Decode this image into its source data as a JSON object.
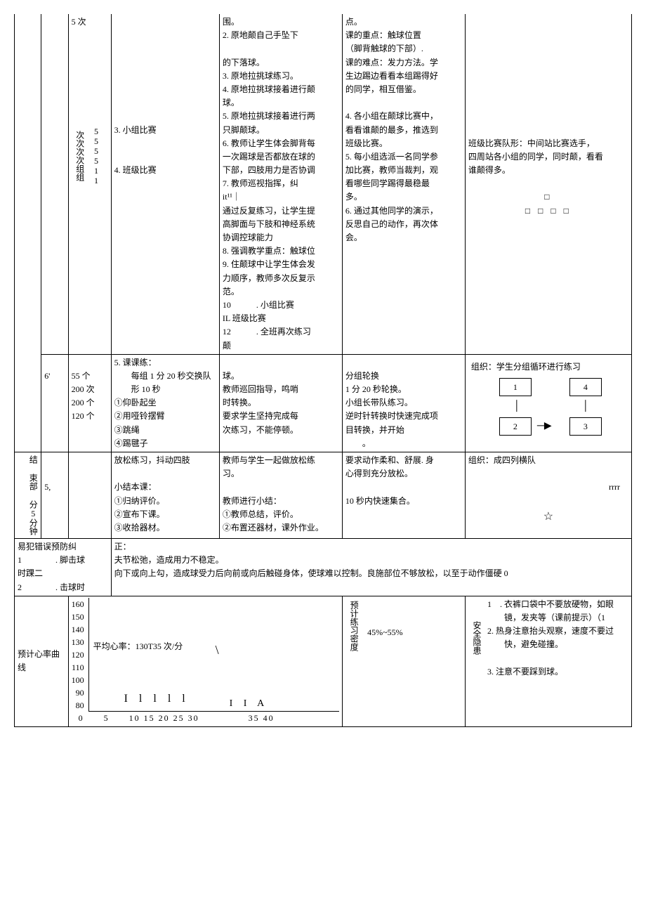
{
  "main": {
    "row1": {
      "reps1": "5 次",
      "reps2_vert": "次次次次组组",
      "reps2_side": "555511",
      "item3": "3. 小组比赛",
      "item4": "4. 班级比赛",
      "mid_a": "围。",
      "mid_b": "2. 原地颠自己手坠下",
      "mid_c": "的下落球。",
      "mid_d": "3. 原地拉挑球练习。",
      "mid_e": "4. 原地拉挑球接着进行颠",
      "mid_f": "球。",
      "mid_g": "5. 原地拉挑球接着进行两",
      "mid_h": "只脚颠球。",
      "mid_i": "6. 教师让学生体会脚背每",
      "mid_j": "一次踢球是否都放在球的",
      "mid_k": "下部，四肢用力是否协调",
      "mid_l": "7. 教师巡视指挥，纠",
      "mid_m": "it¹¹｜",
      "mid_n": "通过反复练习，让学生提",
      "mid_o": "高脚面与下肢和神经系统",
      "mid_p": "协调控球能力",
      "mid_q": "8. 强调教学重点：触球位",
      "mid_r": "9. 住颠球中让学生体会发",
      "mid_s": "力顺序，教师多次反复示",
      "mid_t": "范。",
      "mid_u": "10　　　. 小组比赛",
      "mid_v": "IL 班级比赛",
      "mid_w": "12　　　. 全班再次练习",
      "mid_x": "颠",
      "right_a": "点。",
      "right_b": "课的重点：触球位置",
      "right_c": "（脚背触球的下部）.",
      "right_d": "课的难点：发力方法。学",
      "right_e": "生边踢边看看本组踢得好",
      "right_f": "的同学，相互借鉴。",
      "right_g": "4. 各小组在颠球比赛中，",
      "right_h": "看看谁颠的最多，推选到",
      "right_i": "班级比赛。",
      "right_j": "5. 每小组选派一名同学参",
      "right_k": "加比赛，教师当裁判，观",
      "right_l": "看哪些同学踢得最稳最",
      "right_m": "多。",
      "right_n": "6. 通过其他同学的演示，",
      "right_o": "反思自己的动作，再次体",
      "right_p": "会。",
      "org1_a": "班级比赛队形：中间站比赛选手，",
      "org1_b": "四周站各小组的同学，同时颠，看看",
      "org1_c": "谁颠得多。",
      "sq1": "□",
      "sq2": "□ □ □ □"
    },
    "row2": {
      "time": "6'",
      "reps_a": "55 个",
      "reps_b": "200 次",
      "reps_c": "200 个",
      "reps_d": "120 个",
      "item5_title": "5. 课课练：",
      "item5_sub": "　　每组 1 分 20 秒交换队",
      "item5_sub2": "　　形 10 秒",
      "item5_1": "①仰卧起坐",
      "item5_2": "②用哑铃摆臂",
      "item5_3": "③跳绳",
      "item5_4": "④踢毽子",
      "mid_a": "球。",
      "mid_b": "教师巡回指导，鸣哨",
      "mid_c": "时转换。",
      "mid_d": "要求学生坚持完成每",
      "mid_e": "次练习，不能停顿。",
      "right_a": "分组轮换",
      "right_b": "1 分 20 秒轮换。",
      "right_c": "小组长带队练习。",
      "right_d": "逆时针转换时快速完成项",
      "right_e": "目转换，并开始",
      "right_f": "　　。",
      "org_a": "组织：学生分组循环进行练习",
      "box1": "1",
      "box2": "2",
      "box3": "3",
      "box4": "4",
      "arrow": "▶"
    },
    "end": {
      "label": "结 束部 分5分钟",
      "time": "5,",
      "left_a": "放松练习，抖动四肢",
      "left_b": "小结本课：",
      "left_c": "①归纳评价。",
      "left_d": "②宣布下课。",
      "left_e": "③收拾器材。",
      "mid_a": "教师与学生一起做放松练",
      "mid_b": "习。",
      "mid_c": "教师进行小结：",
      "mid_d": "①教师总结，评价。",
      "mid_e": "②布置还器材，课外作业。",
      "right_a": "要求动作柔和、舒展. 身",
      "right_b": "心得到充分放松。",
      "right_c": "10 秒内快速集合。",
      "org_a": "组织：成四列横队",
      "org_b": "rrrr",
      "org_c": "☆"
    }
  },
  "errors": {
    "title": "易犯错误预防纠",
    "line1": "1　　　　. 脚击球",
    "line2": "时踝二",
    "line3": "2　　　　. 击球时",
    "r1": "正：",
    "r2": "夫节松弛，造成用力不稳定。",
    "r3": "向下或向上勾，造成球受力后向前或向后触碰身体，使球难以控制。良施部位不够放松，以至于动作僵硬 0"
  },
  "bottom": {
    "hr_label": "预计心率曲线",
    "y_vals": [
      "160",
      "150",
      "140",
      "130",
      "120",
      "110",
      "100",
      "90",
      "80"
    ],
    "avg_hr": "平均心率：130T35 次/分",
    "slash": "\\",
    "bars": "I l l l l",
    "iia": "I I A",
    "x_vals": "0　　5　　10 15 20 25 30　　　　　35 40",
    "density_label": "预计练习密度",
    "density_val": "45%~55%",
    "safety_label": "安全隐患",
    "s1": "1　. 衣裤口袋中不要放硬物，如眼",
    "s1b": "　　镜，发夹等（课前提示）（1",
    "s2": "2. 热身注意抬头观察，速度不要过",
    "s2b": "　　快，避免碰撞。",
    "s3": "3. 注意不要踩到球。"
  }
}
